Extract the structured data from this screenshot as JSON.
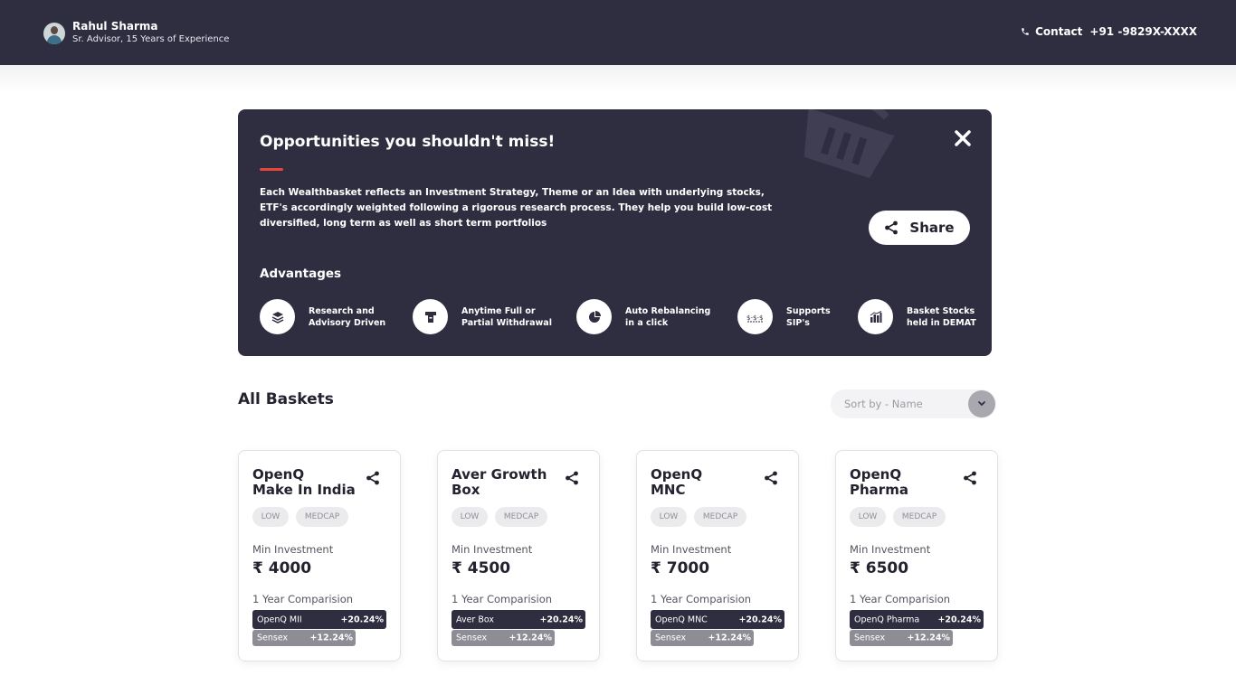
{
  "header": {
    "advisor_name": "Rahul Sharma",
    "advisor_subtitle": "Sr. Advisor, 15 Years of Experience",
    "contact_label": "Contact",
    "contact_number": "+91 -9829X-XXXX"
  },
  "hero": {
    "title": "Opportunities you shouldn't miss!",
    "description": "Each Wealthbasket reflects an Investment Strategy, Theme or an Idea with underlying stocks, ETF's accordingly weighted following a rigorous research process. They help you build low-cost diversified, long term as well as short term portfolios",
    "share_label": "Share",
    "advantages_title": "Advantages",
    "advantages": [
      {
        "label": "Research and\nAdvisory Driven",
        "icon": "layers-icon"
      },
      {
        "label": "Anytime Full or\nPartial Withdrawal",
        "icon": "withdrawal-icon"
      },
      {
        "label": "Auto Rebalancing\nin a click",
        "icon": "pie-chart-icon"
      },
      {
        "label": "Supports\nSIP's",
        "icon": "sip-icon"
      },
      {
        "label": "Basket Stocks\nheld in DEMAT",
        "icon": "demat-icon"
      }
    ]
  },
  "baskets_section": {
    "title": "All Baskets",
    "sort_placeholder": "Sort by - Name"
  },
  "baskets": [
    {
      "name": "OpenQ\nMake In India",
      "risk": "LOW",
      "cap": "MEDCAP",
      "min_label": "Min Investment",
      "min_amount": "₹ 4000",
      "cmp_label": "1 Year Comparision",
      "basket_bench": "OpenQ MII",
      "basket_return": "+20.24%",
      "index_name": "Sensex",
      "index_return": "+12.24%"
    },
    {
      "name": "Aver Growth\nBox",
      "risk": "LOW",
      "cap": "MEDCAP",
      "min_label": "Min Investment",
      "min_amount": "₹ 4500",
      "cmp_label": "1 Year Comparision",
      "basket_bench": "Aver Box",
      "basket_return": "+20.24%",
      "index_name": "Sensex",
      "index_return": "+12.24%"
    },
    {
      "name": "OpenQ\nMNC",
      "risk": "LOW",
      "cap": "MEDCAP",
      "min_label": "Min Investment",
      "min_amount": "₹ 7000",
      "cmp_label": "1 Year Comparision",
      "basket_bench": "OpenQ MNC",
      "basket_return": "+20.24%",
      "index_name": "Sensex",
      "index_return": "+12.24%"
    },
    {
      "name": "OpenQ\nPharma",
      "risk": "LOW",
      "cap": "MEDCAP",
      "min_label": "Min Investment",
      "min_amount": "₹ 6500",
      "cmp_label": "1 Year Comparision",
      "basket_bench": "OpenQ Pharma",
      "basket_return": "+20.24%",
      "index_name": "Sensex",
      "index_return": "+12.24%"
    }
  ]
}
